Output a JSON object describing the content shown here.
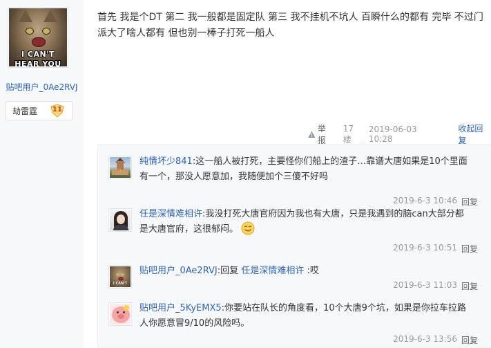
{
  "poster": {
    "avatar_caption_line1": "I CAN'T",
    "avatar_caption_line2": "HEAR YOU",
    "username": "贴吧用户_0Ae2RVJ",
    "badge_name": "劫雷霆",
    "badge_level": "11"
  },
  "post": {
    "content_line1": "首先 我是个DT 第二 我一般都是固定队 第三 我不挂机不坑人 百瞬什么的都有 完毕 不过门",
    "content_line2": "派大了啥人都有 但也别一棒子打死一船人",
    "report_label": "举报",
    "floor": "17楼",
    "time": "2019-06-03 10:28",
    "collapse_label": "收起回复"
  },
  "replies": [
    {
      "avatar": "castle-avatar",
      "user": "纯情坏少841",
      "line1": "这一船人被打死，主要怪你们船上的渣子…靠谱大唐如果是10个里面",
      "line2": "有一个，那没人愿意加，我随便加个三傻不好吗",
      "time": "2019-6-3 10:46",
      "reply_label": "回复"
    },
    {
      "avatar": "girl-avatar",
      "user": "任是深情难相许",
      "line1": "我没打死大唐官府因为我也有大唐，只是我遇到的脑can大部分都",
      "line2": "是大唐官府，这很郁闷。",
      "emoji": "smile-emoji",
      "time": "2019-6-3 10:51",
      "reply_label": "回复"
    },
    {
      "avatar": "cat-avatar",
      "user": "贴吧用户_0Ae2RVJ",
      "prefix": "回复",
      "target": "任是深情难相许",
      "line1": ":哎",
      "avatar_caption": "I CAN'T",
      "time": "2019-6-3 11:03",
      "reply_label": "回复"
    },
    {
      "avatar": "pig-avatar",
      "user": "贴吧用户_5KyEMX5",
      "line1": "你要站在队长的角度看，10个大唐9个坑，如果是你拉车拉路",
      "line2": "人你愿意冒9/10的风险吗。",
      "time": "2019-6-3 13:56",
      "reply_label": "回复"
    }
  ]
}
